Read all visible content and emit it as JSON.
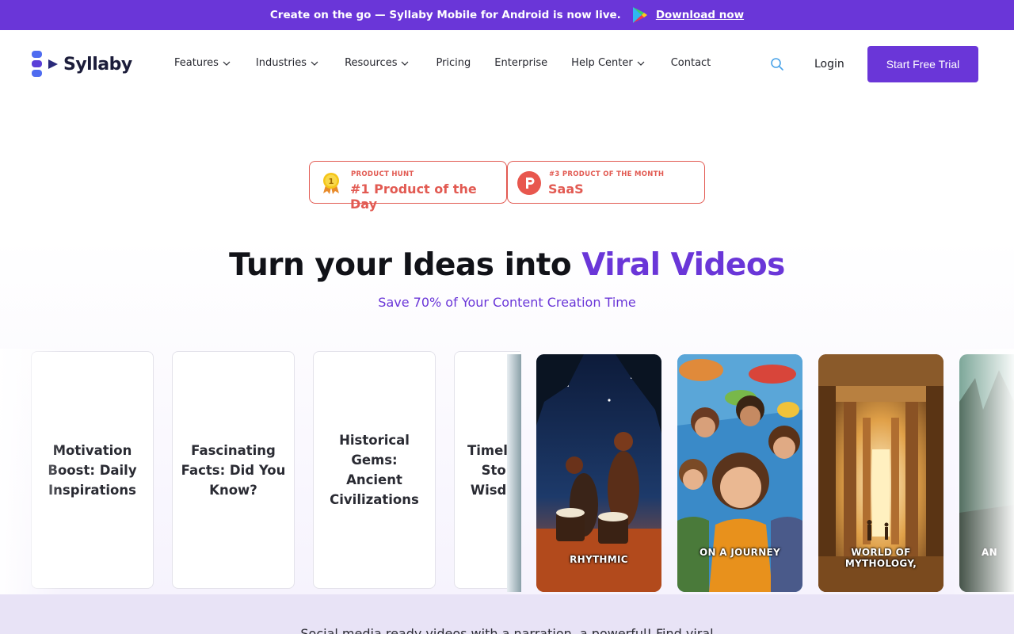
{
  "banner": {
    "text": "Create on the go — Syllaby Mobile for Android is now live.",
    "link": "Download now",
    "icon": "google-play-icon"
  },
  "brand": {
    "name": "Syllaby",
    "color": "#6a36d8"
  },
  "nav": {
    "items": [
      {
        "label": "Features",
        "dropdown": true
      },
      {
        "label": "Industries",
        "dropdown": true
      },
      {
        "label": "Resources",
        "dropdown": true
      },
      {
        "label": "Pricing",
        "dropdown": false
      },
      {
        "label": "Enterprise",
        "dropdown": false
      },
      {
        "label": "Help Center",
        "dropdown": true
      },
      {
        "label": "Contact",
        "dropdown": false
      }
    ],
    "login": "Login",
    "cta": "Start Free Trial"
  },
  "badges": [
    {
      "caption": "PRODUCT HUNT",
      "value": "#1 Product of the Day",
      "icon": "medal-icon"
    },
    {
      "caption": "#3 PRODUCT OF THE MONTH",
      "value": "SaaS",
      "icon": "product-hunt-icon"
    }
  ],
  "hero": {
    "title_start": "Turn your Ideas into ",
    "title_highlight": "Viral Videos",
    "subtitle": "Save 70% of Your Content Creation Time"
  },
  "topic_cards": [
    {
      "label": "Motivation Boost: Daily Inspirations"
    },
    {
      "label": "Fascinating Facts: Did You Know?"
    },
    {
      "label": "Historical Gems: Ancient Civilizations"
    },
    {
      "label": "Timeless Stoic Wisdom"
    }
  ],
  "video_cards": [
    {
      "caption": "RHYTHMIC"
    },
    {
      "caption": "ON A JOURNEY"
    },
    {
      "caption": "WORLD OF MYTHOLOGY,"
    },
    {
      "caption": "AN"
    }
  ],
  "bottom_text": "Social media ready videos with a narration, a powerful! Find viral"
}
